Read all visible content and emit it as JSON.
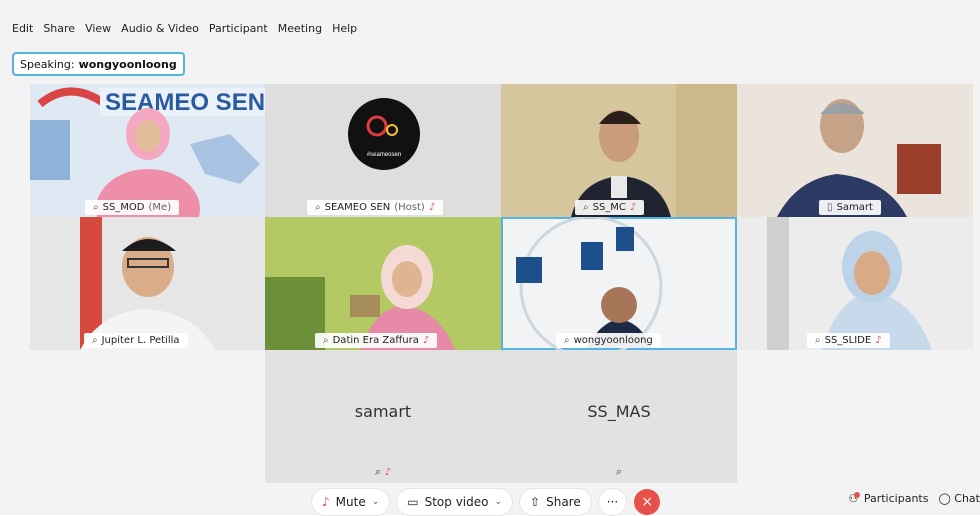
{
  "menu": [
    {
      "label": "Edit"
    },
    {
      "label": "Share"
    },
    {
      "label": "View"
    },
    {
      "label": "Audio & Video"
    },
    {
      "label": "Participant"
    },
    {
      "label": "Meeting"
    },
    {
      "label": "Help"
    }
  ],
  "speaking": {
    "prefix": "Speaking:",
    "name": "wongyoonloong"
  },
  "tiles": {
    "t1": {
      "name": "SS_MOD",
      "suffix": "(Me)"
    },
    "t2": {
      "name": "SEAMEO SEN",
      "suffix": "(Host)",
      "logo_text": "#seameosen"
    },
    "t3": {
      "name": "SS_MC"
    },
    "t4": {
      "name": "Samart"
    },
    "t5": {
      "name": "Jupiter L. Petilla"
    },
    "t6": {
      "name": "Datin Era Zaffura"
    },
    "t7": {
      "name": "wongyoonloong"
    },
    "t8": {
      "name": "SS_SLIDE"
    },
    "t9": {
      "name": "samart"
    },
    "t10": {
      "name": "SS_MAS"
    }
  },
  "toolbar": {
    "mute": "Mute",
    "stop_video": "Stop video",
    "share": "Share",
    "more": "···",
    "end": "×",
    "participants": "Participants",
    "chat": "Chat"
  },
  "colors": {
    "accent": "#56b4e3",
    "end": "#e8504a",
    "muted": "#e0524b"
  }
}
